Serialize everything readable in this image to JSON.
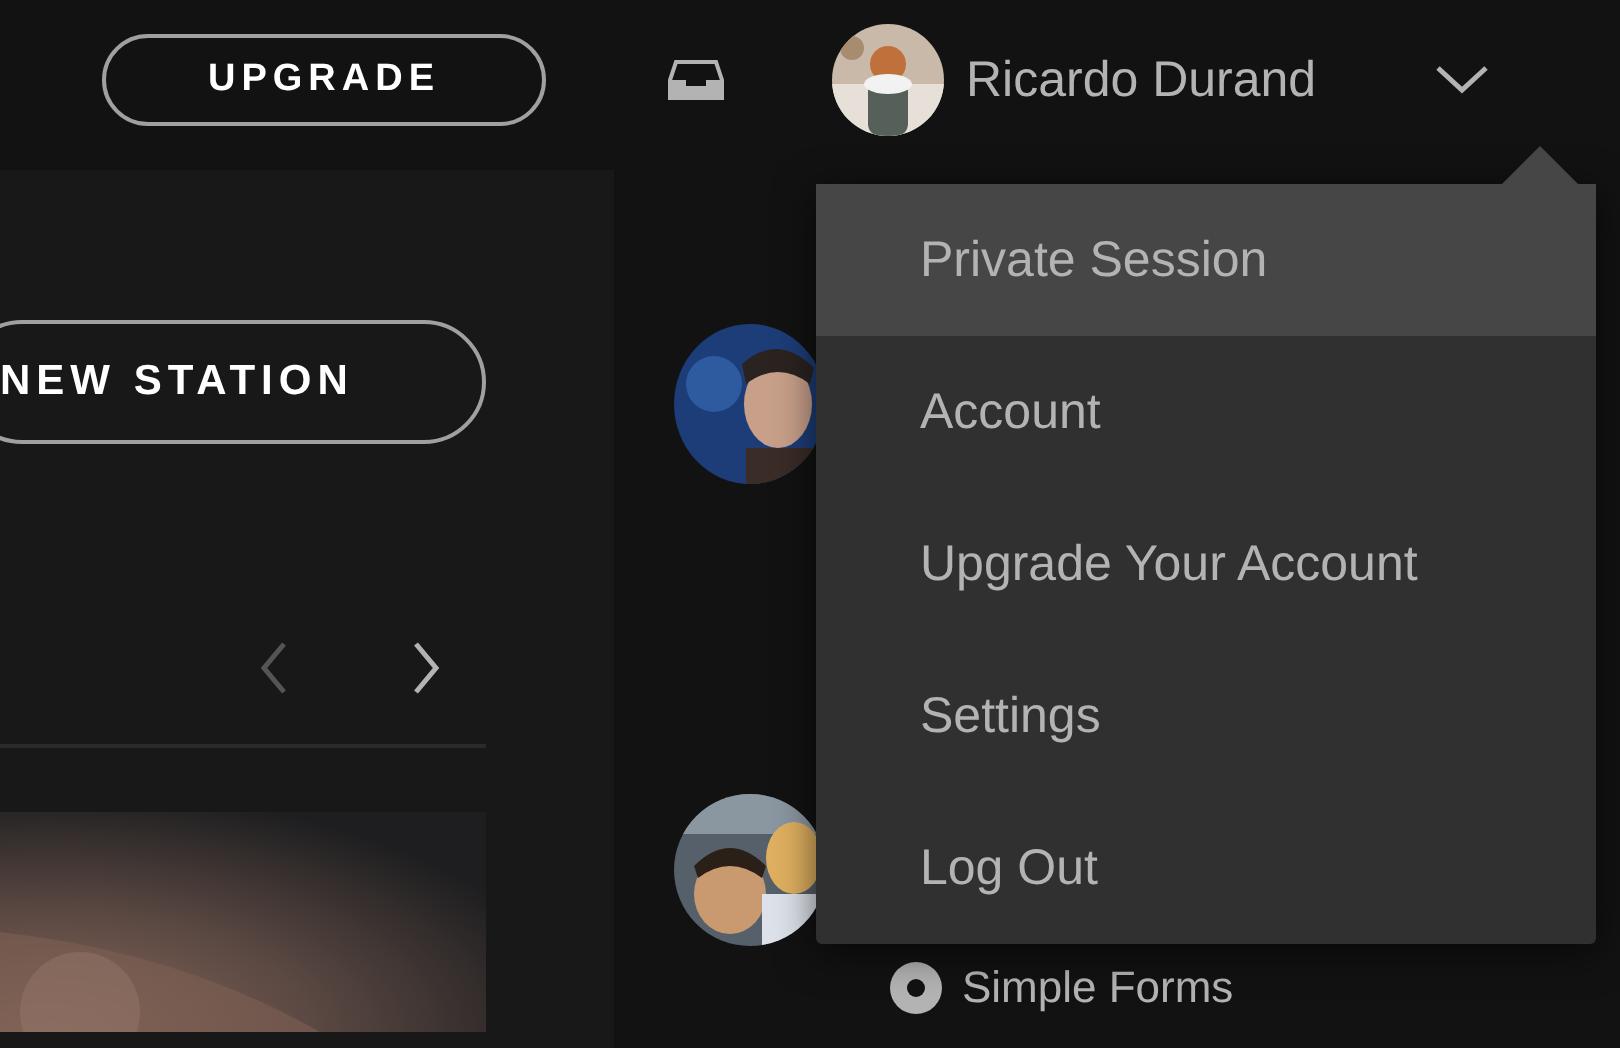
{
  "top_bar": {
    "upgrade_button": "UPGRADE",
    "user_name": "Ricardo Durand"
  },
  "station": {
    "button": "NEW STATION",
    "nav": {
      "previous_disabled": true,
      "next_disabled": false
    }
  },
  "feed": {
    "label": "Simple Forms"
  },
  "menu": {
    "items": [
      {
        "label": "Private Session",
        "selected": true
      },
      {
        "label": "Account",
        "selected": false
      },
      {
        "label": "Upgrade Your Account",
        "selected": false
      },
      {
        "label": "Settings",
        "selected": false
      },
      {
        "label": "Log Out",
        "selected": false
      }
    ]
  }
}
